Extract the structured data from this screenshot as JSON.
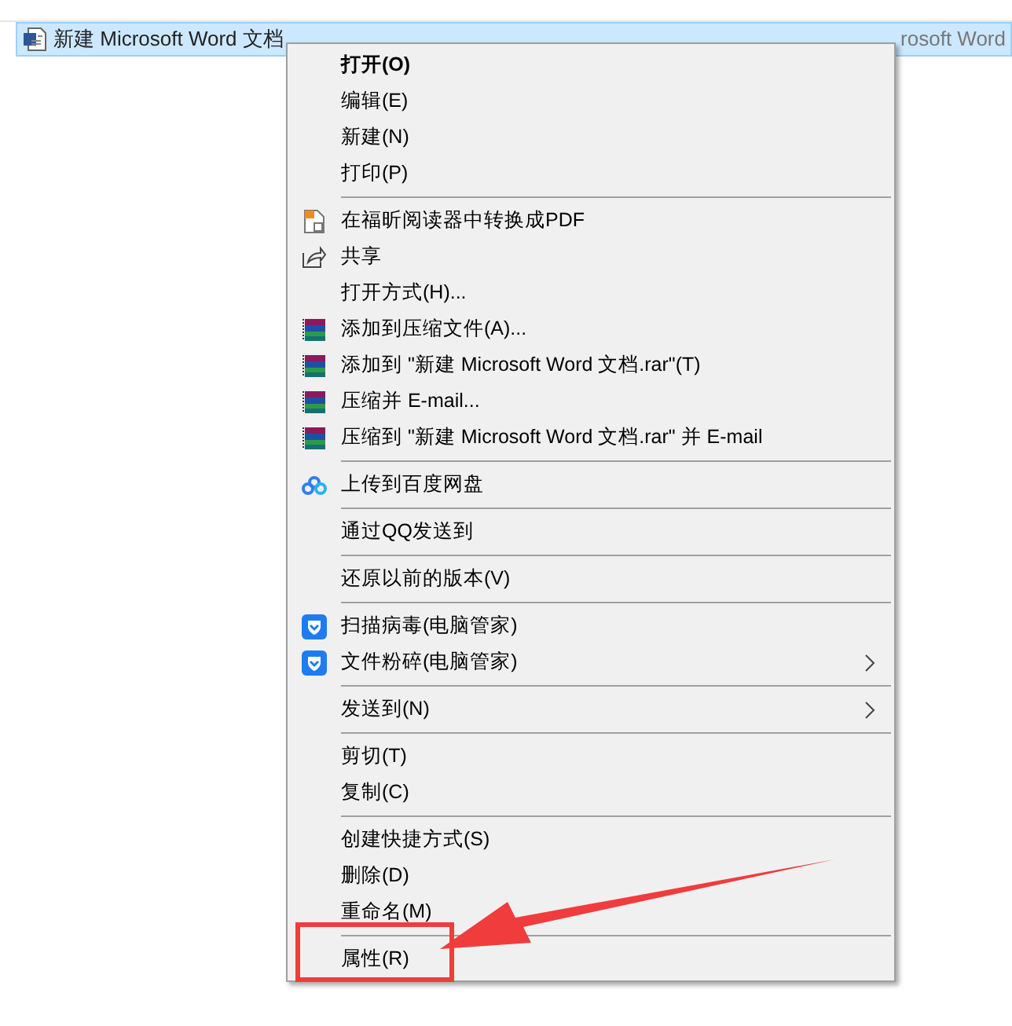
{
  "file_row": {
    "name": "新建 Microsoft Word 文档",
    "type": "rosoft Word",
    "selected": true
  },
  "context_menu": {
    "items": [
      {
        "kind": "plain",
        "label": "打开(O)",
        "bold": true,
        "submenu": false
      },
      {
        "kind": "plain",
        "label": "编辑(E)",
        "bold": false,
        "submenu": false
      },
      {
        "kind": "plain",
        "label": "新建(N)",
        "bold": false,
        "submenu": false
      },
      {
        "kind": "plain",
        "label": "打印(P)",
        "bold": false,
        "submenu": false
      },
      {
        "kind": "separator"
      },
      {
        "kind": "pdf",
        "label": "在福昕阅读器中转换成PDF",
        "bold": false,
        "submenu": false
      },
      {
        "kind": "share",
        "label": "共享",
        "bold": false,
        "submenu": false
      },
      {
        "kind": "plain",
        "label": "打开方式(H)...",
        "bold": false,
        "submenu": false
      },
      {
        "kind": "archive",
        "label": "添加到压缩文件(A)...",
        "bold": false,
        "submenu": false
      },
      {
        "kind": "archive",
        "label": "添加到 \"新建 Microsoft Word 文档.rar\"(T)",
        "bold": false,
        "submenu": false
      },
      {
        "kind": "archive",
        "label": "压缩并 E-mail...",
        "bold": false,
        "submenu": false
      },
      {
        "kind": "archive",
        "label": "压缩到 \"新建 Microsoft Word 文档.rar\" 并 E-mail",
        "bold": false,
        "submenu": false
      },
      {
        "kind": "separator"
      },
      {
        "kind": "cloud",
        "label": "上传到百度网盘",
        "bold": false,
        "submenu": false
      },
      {
        "kind": "separator"
      },
      {
        "kind": "plain",
        "label": "通过QQ发送到",
        "bold": false,
        "submenu": false
      },
      {
        "kind": "separator"
      },
      {
        "kind": "plain",
        "label": "还原以前的版本(V)",
        "bold": false,
        "submenu": false
      },
      {
        "kind": "separator"
      },
      {
        "kind": "shield",
        "label": "扫描病毒(电脑管家)",
        "bold": false,
        "submenu": false
      },
      {
        "kind": "shield",
        "label": "文件粉碎(电脑管家)",
        "bold": false,
        "submenu": true
      },
      {
        "kind": "separator"
      },
      {
        "kind": "plain",
        "label": "发送到(N)",
        "bold": false,
        "submenu": true
      },
      {
        "kind": "separator"
      },
      {
        "kind": "plain",
        "label": "剪切(T)",
        "bold": false,
        "submenu": false
      },
      {
        "kind": "plain",
        "label": "复制(C)",
        "bold": false,
        "submenu": false
      },
      {
        "kind": "separator"
      },
      {
        "kind": "plain",
        "label": "创建快捷方式(S)",
        "bold": false,
        "submenu": false
      },
      {
        "kind": "plain",
        "label": "删除(D)",
        "bold": false,
        "submenu": false
      },
      {
        "kind": "plain",
        "label": "重命名(M)",
        "bold": false,
        "submenu": false
      },
      {
        "kind": "separator"
      },
      {
        "kind": "plain",
        "label": "属性(R)",
        "bold": false,
        "submenu": false,
        "highlighted": true
      }
    ]
  }
}
